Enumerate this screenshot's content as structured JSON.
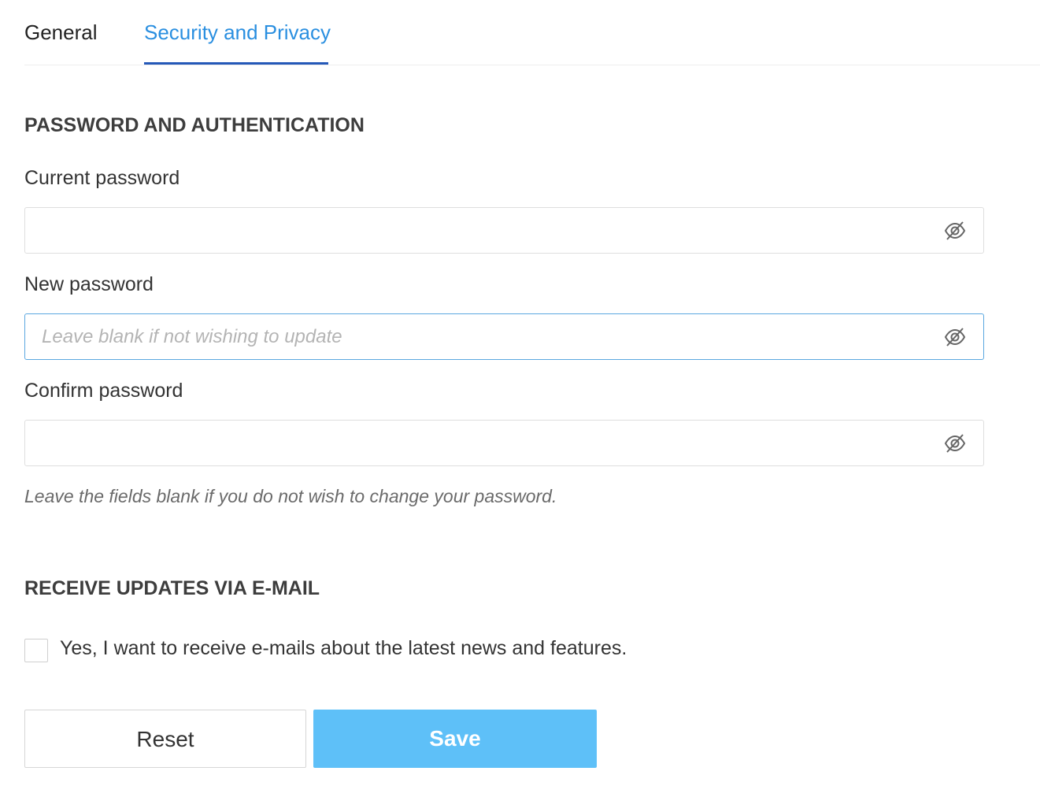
{
  "tabs": [
    {
      "label": "General",
      "active": false
    },
    {
      "label": "Security and Privacy",
      "active": true
    }
  ],
  "password_section": {
    "title": "PASSWORD AND AUTHENTICATION",
    "current": {
      "label": "Current password",
      "value": "",
      "placeholder": "",
      "icon": "eye-slash-icon"
    },
    "new": {
      "label": "New password",
      "value": "",
      "placeholder": "Leave blank if not wishing to update",
      "icon": "eye-slash-icon"
    },
    "confirm": {
      "label": "Confirm password",
      "value": "",
      "placeholder": "",
      "icon": "eye-slash-icon"
    },
    "hint": "Leave the fields blank if you do not wish to change your password."
  },
  "email_section": {
    "title": "RECEIVE UPDATES VIA E-MAIL",
    "checkbox_label": "Yes, I want to receive e-mails about the latest news and features.",
    "checked": false
  },
  "actions": {
    "reset_label": "Reset",
    "save_label": "Save"
  },
  "colors": {
    "accent": "#2a8fe0",
    "tab_underline": "#2458b8",
    "save_button": "#5ec0f8",
    "focus_border": "#5aa7e0"
  }
}
